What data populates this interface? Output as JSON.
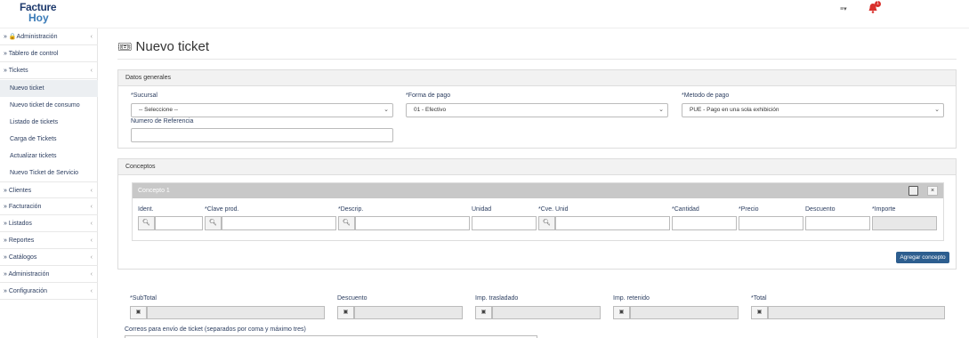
{
  "brand": {
    "logo_line1": "Facture",
    "logo_line2": "Hoy"
  },
  "header": {
    "menu_glyph": "≡▾"
  },
  "sidebar": {
    "items": [
      {
        "label": "» 🔒Administración"
      },
      {
        "label": "» Tablero de control"
      },
      {
        "label": "» Tickets"
      }
    ],
    "sub_items": [
      {
        "label": "Nuevo ticket",
        "active": true
      },
      {
        "label": "Nuevo ticket de consumo"
      },
      {
        "label": "Listado de tickets"
      },
      {
        "label": "Carga de Tickets"
      },
      {
        "label": "Actualizar tickets"
      },
      {
        "label": "Nuevo Ticket de Servicio"
      }
    ],
    "items_after": [
      {
        "label": "» Clientes"
      },
      {
        "label": "» Facturación"
      },
      {
        "label": "» Listados"
      },
      {
        "label": "» Reportes"
      },
      {
        "label": "» Catálogos"
      },
      {
        "label": "» Administración"
      },
      {
        "label": "» Configuración"
      }
    ],
    "chevron": "‹"
  },
  "page": {
    "title": "Nuevo ticket"
  },
  "datos_generales": {
    "header": "Datos generales",
    "sucursal_label": "*Sucursal",
    "sucursal_value": "-- Seleccione --",
    "forma_pago_label": "*Forma de pago",
    "forma_pago_value": "01 - Efectivo",
    "metodo_pago_label": "*Metodo de pago",
    "metodo_pago_value": "PUE - Pago en una sola exhibición",
    "referencia_label": "Numero de Referencia"
  },
  "conceptos": {
    "header": "Conceptos",
    "concepto_title": "Concepto 1",
    "close_glyph": "×",
    "columns": {
      "ident": "Ident.",
      "clave_prod": "*Clave prod.",
      "descrip": "*Descrip.",
      "unidad": "Unidad",
      "cve_unid": "*Cve. Unid",
      "cantidad": "*Cantidad",
      "precio": "*Precio",
      "descuento": "Descuento",
      "importe": "*Importe"
    },
    "search_glyph": "🔍",
    "add_button": "Agregar concepto"
  },
  "totals": {
    "subtotal": "*SubTotal",
    "descuento": "Descuento",
    "imp_trasladado": "Imp. trasladado",
    "imp_retenido": "Imp. retenido",
    "total": "*Total",
    "money_glyph": "💵"
  },
  "emails": {
    "label": "Correos para envío de ticket (separados por coma y máximo tres)"
  }
}
